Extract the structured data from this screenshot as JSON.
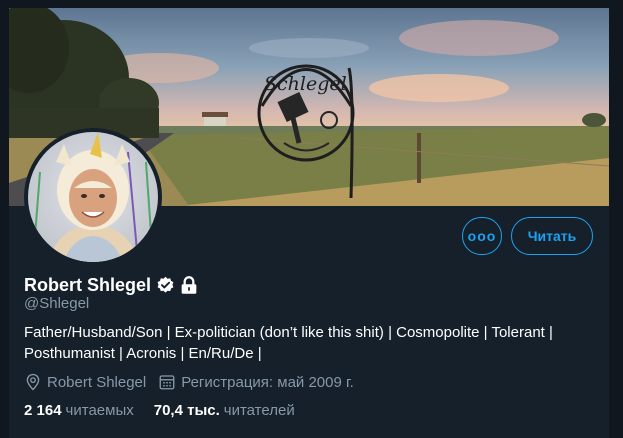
{
  "profile": {
    "name": "Robert Shlegel",
    "handle": "@Shlegel",
    "bio_line1": "Father/Husband/Son | Ex-politician (don’t like this shit) | Cosmopolite | Tolerant |",
    "bio_line2": "Posthumanist | Acronis | En/Ru/De |",
    "location": "Robert Shlegel",
    "joined": "Регистрация: май 2009 г.",
    "sign_text": "Schlegel"
  },
  "stats": {
    "following_count": "2 164",
    "following_label": "читаемых",
    "followers_count": "70,4 тыс.",
    "followers_label": "читателей"
  },
  "actions": {
    "more_label": "ooo",
    "follow_label": "Читать"
  },
  "icons": {
    "verified": "verified-badge-icon",
    "protected": "lock-icon",
    "location": "location-pin-icon",
    "joined": "calendar-icon",
    "more": "more-dots-icon"
  },
  "colors": {
    "background": "#15202b",
    "accent": "#1da1f2",
    "secondary_text": "#8899a6",
    "primary_text": "#ffffff"
  }
}
